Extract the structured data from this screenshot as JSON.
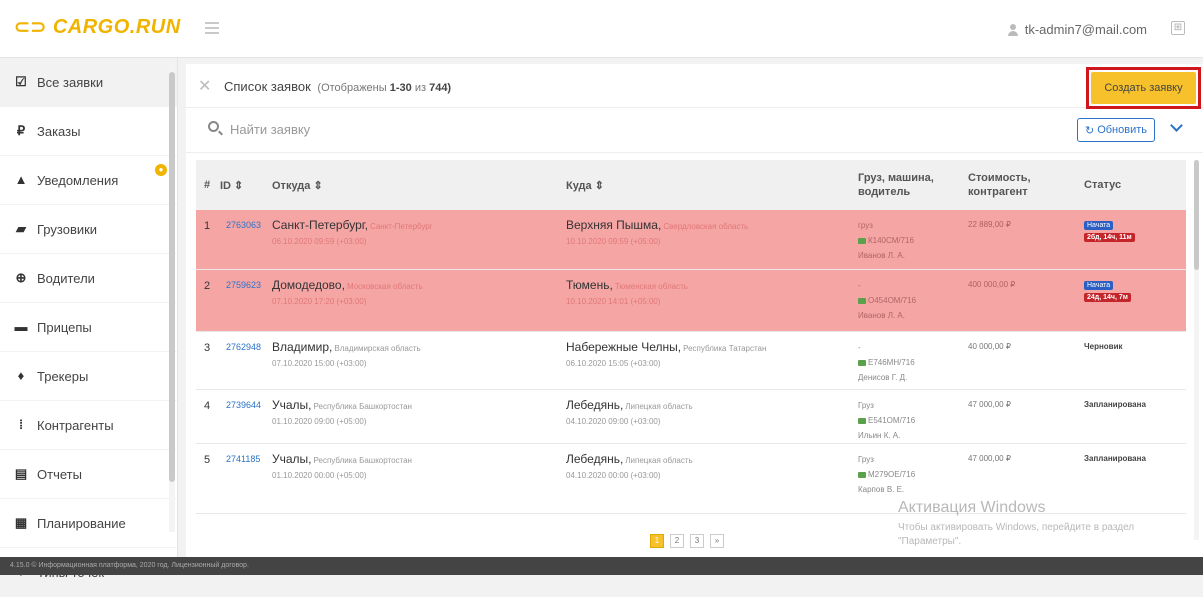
{
  "header": {
    "logo": "CARGO.RUN",
    "user_email": "tk-admin7@mail.com"
  },
  "sidebar": {
    "items": [
      {
        "label": "Все заявки",
        "icon": "checkbox-icon",
        "glyph": "☑"
      },
      {
        "label": "Заказы",
        "icon": "ruble-icon",
        "glyph": "₽"
      },
      {
        "label": "Уведомления",
        "icon": "bell-icon",
        "glyph": "▲"
      },
      {
        "label": "Грузовики",
        "icon": "truck-icon",
        "glyph": "▰"
      },
      {
        "label": "Водители",
        "icon": "steering-wheel-icon",
        "glyph": "⊕"
      },
      {
        "label": "Прицепы",
        "icon": "trailer-icon",
        "glyph": "▬"
      },
      {
        "label": "Трекеры",
        "icon": "map-marker-icon",
        "glyph": "♦"
      },
      {
        "label": "Контрагенты",
        "icon": "contractors-icon",
        "glyph": "⁞"
      },
      {
        "label": "Отчеты",
        "icon": "report-icon",
        "glyph": "▤"
      },
      {
        "label": "Планирование",
        "icon": "calendar-icon",
        "glyph": "▦"
      },
      {
        "label": "Типы точек",
        "icon": "map-marker-icon",
        "glyph": "♦"
      }
    ]
  },
  "main": {
    "title": "Список заявок",
    "subtitle_prefix": "(Отображены",
    "subtitle_range": "1-30",
    "subtitle_of": "из",
    "subtitle_total": "744)",
    "create_button": "Создать заявку",
    "search_placeholder": "Найти заявку",
    "refresh_button": "Обновить"
  },
  "table": {
    "columns": {
      "num": "#",
      "id": "ID ⇕",
      "from": "Откуда ⇕",
      "to": "Куда ⇕",
      "cargo": "Груз, машина, водитель",
      "cost": "Стоимость, контрагент",
      "status": "Статус"
    },
    "rows": [
      {
        "num": "1",
        "id": "2763063",
        "from_city": "Санкт-Петербург,",
        "from_region": "Санкт-Петербург",
        "from_date": "06.10.2020 09:59 (+03:00)",
        "to_city": "Верхняя Пышма,",
        "to_region": "Свердловская область",
        "to_date": "10.10.2020 09:59 (+05:00)",
        "cargo": "груз",
        "truck": "К140СМ/716",
        "driver": "Иванов Л. А.",
        "cost": "22 889,00 ₽",
        "status_plain": "",
        "status_badge": "Начата",
        "status_timer": "2бд, 14ч, 11м"
      },
      {
        "num": "2",
        "id": "2759623",
        "from_city": "Домодедово,",
        "from_region": "Московская область",
        "from_date": "07.10.2020 17:20 (+03:00)",
        "to_city": "Тюмень,",
        "to_region": "Тюменская область",
        "to_date": "10.10.2020 14:01 (+05:00)",
        "cargo": "-",
        "truck": "О454ОМ/716",
        "driver": "Иванов Л. А.",
        "cost": "400 000,00 ₽",
        "status_plain": "",
        "status_badge": "Начата",
        "status_timer": "24д, 14ч, 7м"
      },
      {
        "num": "3",
        "id": "2762948",
        "from_city": "Владимир,",
        "from_region": "Владимирская область",
        "from_date": "07.10.2020 15:00 (+03:00)",
        "to_city": "Набережные Челны,",
        "to_region": "Республика Татарстан",
        "to_date": "06.10.2020 15:05 (+03:00)",
        "cargo": "-",
        "truck": "Е746МН/716",
        "driver": "Денисов Г. Д.",
        "cost": "40 000,00 ₽",
        "status_plain": "Черновик",
        "status_badge": "",
        "status_timer": ""
      },
      {
        "num": "4",
        "id": "2739644",
        "from_city": "Учалы,",
        "from_region": "Республика Башкортостан",
        "from_date": "01.10.2020 09:00 (+05:00)",
        "to_city": "Лебедянь,",
        "to_region": "Липецкая область",
        "to_date": "04.10.2020 09:00 (+03:00)",
        "cargo": "Груз",
        "truck": "Е541ОМ/716",
        "driver": "Ильин К. А.",
        "cost": "47 000,00 ₽",
        "status_plain": "Запланирована",
        "status_badge": "",
        "status_timer": ""
      },
      {
        "num": "5",
        "id": "2741185",
        "from_city": "Учалы,",
        "from_region": "Республика Башкортостан",
        "from_date": "01.10.2020 00:00 (+05:00)",
        "to_city": "Лебедянь,",
        "to_region": "Липецкая область",
        "to_date": "04.10.2020 00:00 (+03:00)",
        "cargo": "Груз",
        "truck": "М279ОЕ/716",
        "driver": "Карпов В. Е.",
        "cost": "47 000,00 ₽",
        "status_plain": "Запланирована",
        "status_badge": "",
        "status_timer": ""
      }
    ]
  },
  "pagination": {
    "pages": [
      "1",
      "2",
      "3",
      "»"
    ],
    "current": "1"
  },
  "windows_activation": {
    "title": "Активация Windows",
    "subtitle": "Чтобы активировать Windows, перейдите в раздел \"Параметры\"."
  },
  "footer": {
    "text": "4.15.0 © Информационная платформа, 2020 год. Лицензионный договор."
  },
  "colors": {
    "brand": "#f0b400",
    "accent": "#2b73c9",
    "row_alert": "#f6a5a5",
    "create_btn": "#f6c12b",
    "highlight_frame": "#d0161d"
  }
}
